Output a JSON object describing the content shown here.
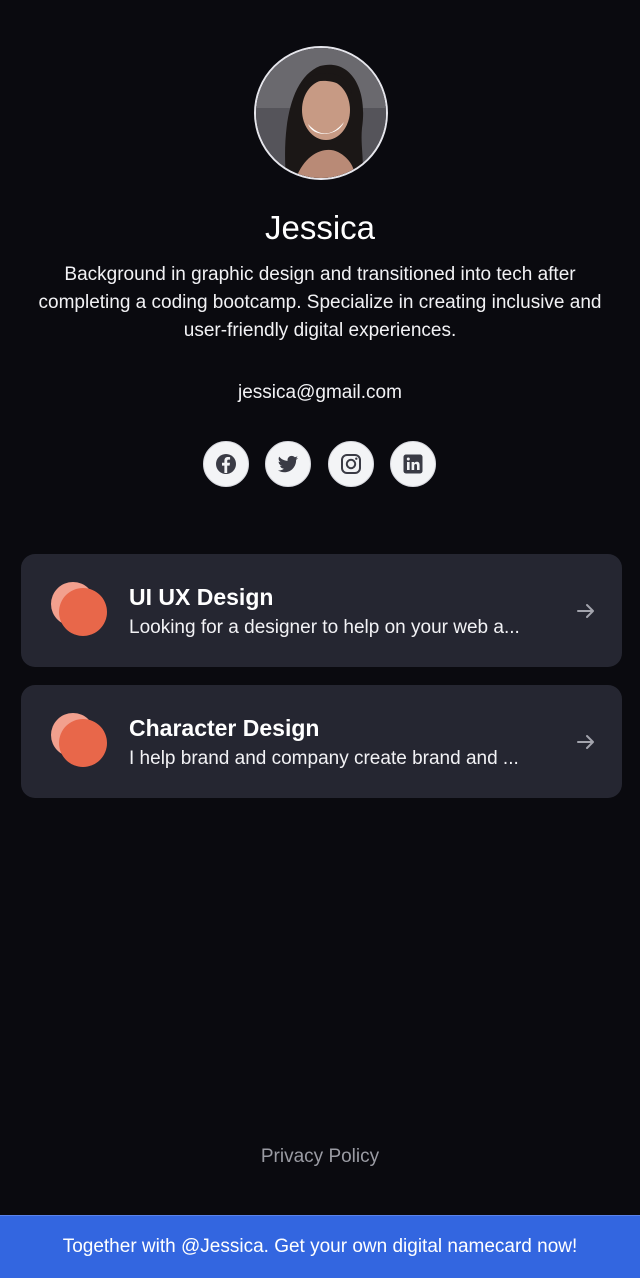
{
  "profile": {
    "name": "Jessica",
    "bio": "Background in graphic design and transitioned into tech after completing a coding bootcamp. Specialize in creating inclusive and user-friendly digital experiences.",
    "email": "jessica@gmail.com",
    "avatar_icon": "profile-photo"
  },
  "socials": [
    {
      "name": "facebook",
      "icon": "facebook-icon"
    },
    {
      "name": "twitter",
      "icon": "twitter-icon"
    },
    {
      "name": "instagram",
      "icon": "instagram-icon"
    },
    {
      "name": "linkedin",
      "icon": "linkedin-icon"
    }
  ],
  "links": [
    {
      "title": "UI UX Design",
      "description": "Looking for a designer to help on your web a...",
      "icon": "arrow-right-icon"
    },
    {
      "title": "Character Design",
      "description": "I help brand and company create brand and ...",
      "icon": "arrow-right-icon"
    }
  ],
  "footer": {
    "privacy_label": "Privacy Policy",
    "banner_text": "Together with @Jessica. Get your own digital namecard now!"
  },
  "colors": {
    "background": "#0a0a0f",
    "card": "#252631",
    "accent_dot": "#e8674a",
    "accent_dot_light": "#f2a08e",
    "banner": "#3366e0"
  }
}
